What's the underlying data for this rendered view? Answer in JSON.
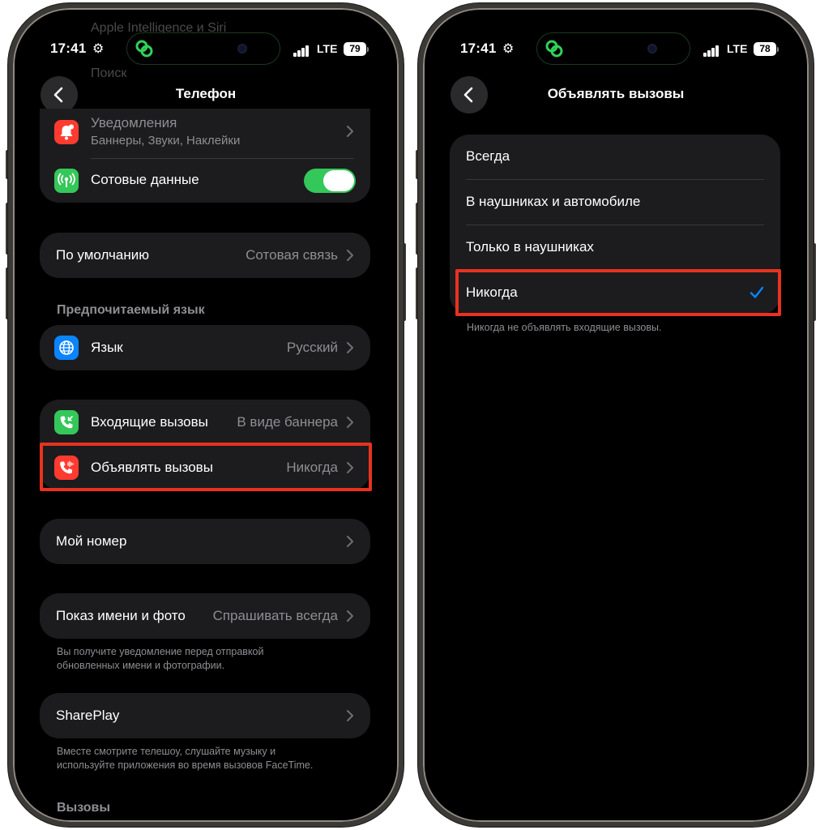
{
  "left": {
    "status": {
      "time": "17:41",
      "network": "LTE",
      "battery": "79"
    },
    "ghost_rows": [
      "Apple Intelligence и Siri",
      "Поиск"
    ],
    "nav": {
      "title": "Телефон"
    },
    "notifications": {
      "label": "Уведомления",
      "sublabel": "Баннеры, Звуки, Наклейки"
    },
    "cellular": {
      "label": "Сотовые данные",
      "enabled": true
    },
    "default_line": {
      "label": "По умолчанию",
      "value": "Сотовая связь"
    },
    "language_section": {
      "header": "Предпочитаемый язык",
      "label": "Язык",
      "value": "Русский"
    },
    "incoming_calls": {
      "label": "Входящие вызовы",
      "value": "В виде баннера"
    },
    "announce_calls": {
      "label": "Объявлять вызовы",
      "value": "Никогда"
    },
    "my_number": {
      "label": "Мой номер"
    },
    "name_photo": {
      "label": "Показ имени и фото",
      "value": "Спрашивать всегда",
      "footer": "Вы получите уведомление перед отправкой обновленных имени и фотографии."
    },
    "shareplay": {
      "label": "SharePlay",
      "footer": "Вместе смотрите телешоу, слушайте музыку и используйте приложения во время вызовов FaceTime."
    },
    "calls_section": {
      "header": "Вызовы"
    }
  },
  "right": {
    "status": {
      "time": "17:41",
      "network": "LTE",
      "battery": "78"
    },
    "nav": {
      "title": "Объявлять вызовы"
    },
    "options": [
      {
        "label": "Всегда",
        "selected": false
      },
      {
        "label": "В наушниках и автомобиле",
        "selected": false
      },
      {
        "label": "Только в наушниках",
        "selected": false
      },
      {
        "label": "Никогда",
        "selected": true
      }
    ],
    "footer": "Никогда не объявлять входящие вызовы."
  },
  "colors": {
    "background": "#000000",
    "group": "#1c1c1e",
    "secondary_text": "#8e8e93",
    "accent_blue": "#0a84ff",
    "toggle_on": "#34c759",
    "highlight_red": "#e8321f",
    "notification_icon": "#ff3b30",
    "cellular_icon": "#34c759",
    "language_icon": "#0a84ff",
    "incoming_icon": "#34c759",
    "announce_icon": "#ff3b30"
  },
  "icons": {
    "back": "chevron-left-icon",
    "disclosure": "chevron-right-icon",
    "notifications": "bell-badge-icon",
    "cellular": "antenna-icon",
    "language": "globe-icon",
    "incoming": "phone-incoming-icon",
    "announce": "phone-waveform-icon",
    "selected": "checkmark-icon",
    "status_extra": "gear-icon",
    "island_activity": "link-circles-icon"
  }
}
